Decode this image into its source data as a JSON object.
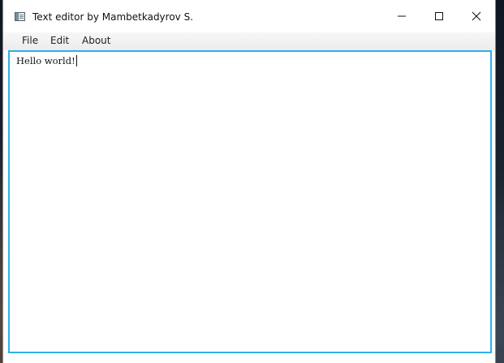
{
  "window": {
    "title": "Text editor by Mambetkadyrov S.",
    "icon": "app-window-icon",
    "controls": {
      "minimize_icon": "minimize-icon",
      "maximize_icon": "maximize-icon",
      "close_icon": "close-icon"
    }
  },
  "menubar": {
    "items": [
      {
        "label": "File"
      },
      {
        "label": "Edit"
      },
      {
        "label": "About"
      }
    ]
  },
  "editor": {
    "content": "Hello world!",
    "focus_border_color": "#2fb0e6"
  }
}
